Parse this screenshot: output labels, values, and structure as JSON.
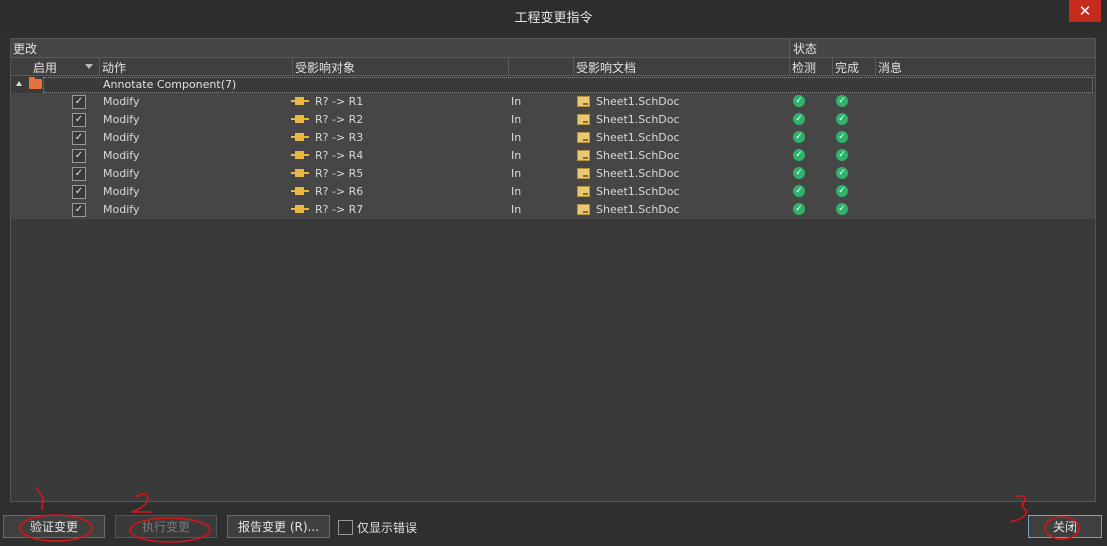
{
  "window": {
    "title": "工程变更指令",
    "close_glyph": "✕"
  },
  "table": {
    "header_groups": {
      "modifications": "更改",
      "status": "状态"
    },
    "columns": {
      "enable": "启用",
      "action": "动作",
      "affected_object": "受影响对象",
      "affected_document": "受影响文档",
      "check": "检测",
      "done": "完成",
      "message": "消息"
    },
    "group": {
      "label": "Annotate Component(7)",
      "icon": "folder-icon"
    },
    "rows": [
      {
        "action": "Modify",
        "object": "R? -> R1",
        "in": "In",
        "document": "Sheet1.SchDoc"
      },
      {
        "action": "Modify",
        "object": "R? -> R2",
        "in": "In",
        "document": "Sheet1.SchDoc"
      },
      {
        "action": "Modify",
        "object": "R? -> R3",
        "in": "In",
        "document": "Sheet1.SchDoc"
      },
      {
        "action": "Modify",
        "object": "R? -> R4",
        "in": "In",
        "document": "Sheet1.SchDoc"
      },
      {
        "action": "Modify",
        "object": "R? -> R5",
        "in": "In",
        "document": "Sheet1.SchDoc"
      },
      {
        "action": "Modify",
        "object": "R? -> R6",
        "in": "In",
        "document": "Sheet1.SchDoc"
      },
      {
        "action": "Modify",
        "object": "R? -> R7",
        "in": "In",
        "document": "Sheet1.SchDoc"
      }
    ]
  },
  "buttons": {
    "validate": "验证变更",
    "execute": "执行变更",
    "report": "报告变更 (R)...",
    "only_errors": "仅显示错误",
    "close": "关闭"
  },
  "annotations": {
    "step1": "1",
    "step2": "2",
    "step3": "3"
  },
  "colors": {
    "accent_red": "#c42b1c",
    "check_green": "#2fb36b",
    "annotation_red": "#d6151a"
  }
}
